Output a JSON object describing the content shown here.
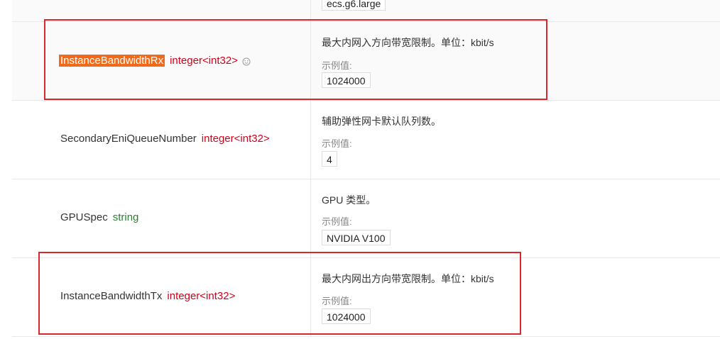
{
  "labels": {
    "example": "示例值:"
  },
  "top_value": "ecs.g6.large",
  "rows": [
    {
      "name": "InstanceBandwidthRx",
      "type": "integer<int32>",
      "type_color": "#d0021b",
      "description": "最大内网入方向带宽限制。单位：kbit/s",
      "example": "1024000"
    },
    {
      "name": "SecondaryEniQueueNumber",
      "type": "integer<int32>",
      "type_color": "#d0021b",
      "description": "辅助弹性网卡默认队列数。",
      "example": "4"
    },
    {
      "name": "GPUSpec",
      "type": "string",
      "type_color": "#2e7d32",
      "description": "GPU 类型。",
      "example": "NVIDIA V100"
    },
    {
      "name": "InstanceBandwidthTx",
      "type": "integer<int32>",
      "type_color": "#d0021b",
      "description": "最大内网出方向带宽限制。单位：kbit/s",
      "example": "1024000"
    }
  ],
  "highlight_color": "#f06a1a",
  "annotation_color": "#d9272e",
  "icons": {
    "rx_row_extra": "smile-icon"
  }
}
